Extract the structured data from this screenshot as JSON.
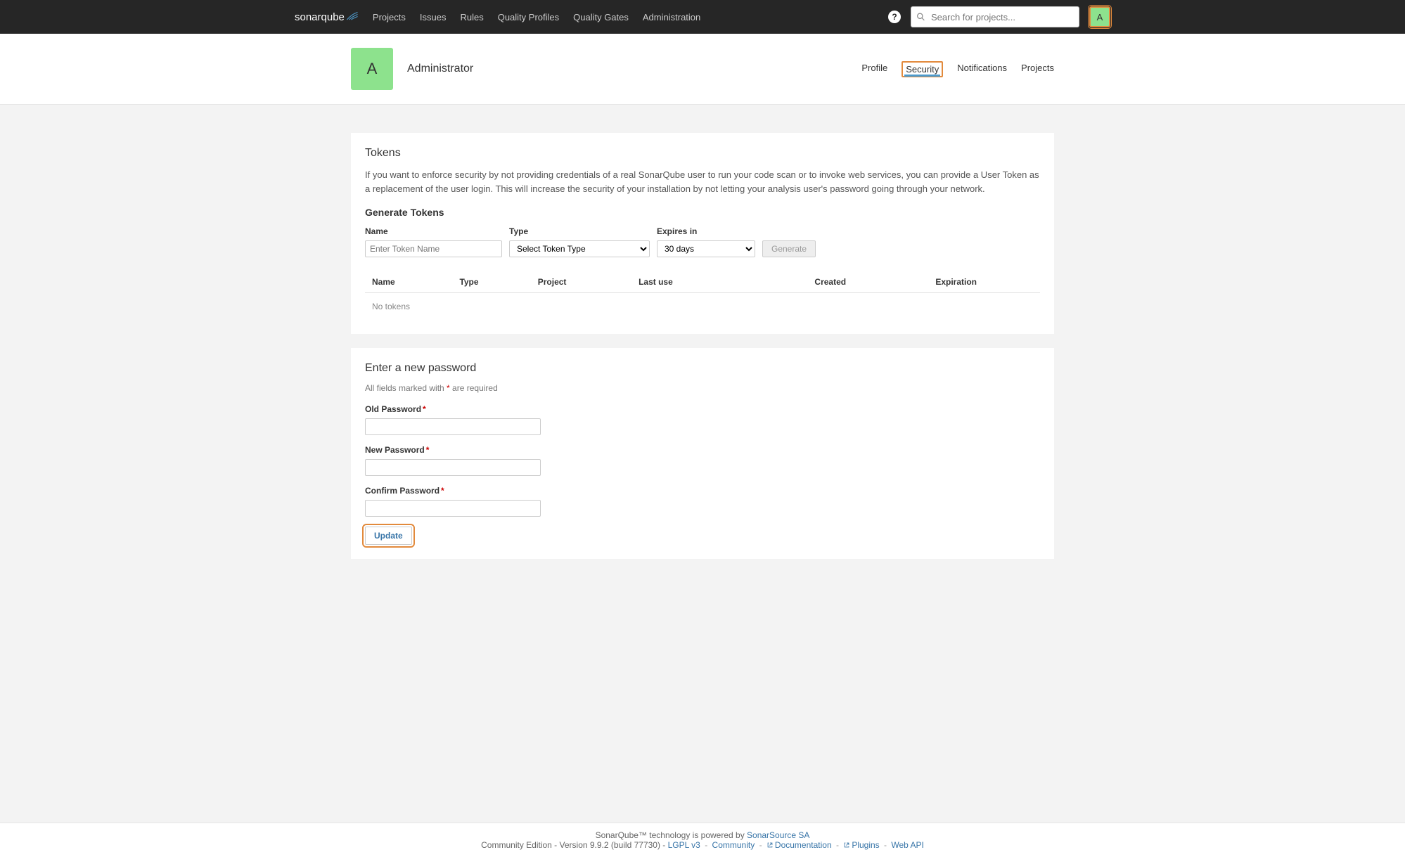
{
  "navbar": {
    "logo_prefix": "sonar",
    "logo_suffix": "qube",
    "links": [
      "Projects",
      "Issues",
      "Rules",
      "Quality Profiles",
      "Quality Gates",
      "Administration"
    ],
    "search_placeholder": "Search for projects...",
    "avatar_letter": "A"
  },
  "profile": {
    "avatar_letter": "A",
    "name": "Administrator",
    "tabs": [
      "Profile",
      "Security",
      "Notifications",
      "Projects"
    ],
    "active_tab": "Security"
  },
  "tokens_panel": {
    "title": "Tokens",
    "description": "If you want to enforce security by not providing credentials of a real SonarQube user to run your code scan or to invoke web services, you can provide a User Token as a replacement of the user login. This will increase the security of your installation by not letting your analysis user's password going through your network.",
    "generate_title": "Generate Tokens",
    "name_label": "Name",
    "name_placeholder": "Enter Token Name",
    "type_label": "Type",
    "type_placeholder": "Select Token Type",
    "expires_label": "Expires in",
    "expires_value": "30 days",
    "generate_btn": "Generate",
    "table": {
      "headers": [
        "Name",
        "Type",
        "Project",
        "Last use",
        "Created",
        "Expiration"
      ],
      "empty": "No tokens"
    }
  },
  "password_panel": {
    "title": "Enter a new password",
    "hint_prefix": "All fields marked with ",
    "hint_mark": "*",
    "hint_suffix": " are required",
    "old_label": "Old Password",
    "new_label": "New Password",
    "confirm_label": "Confirm Password",
    "update_btn": "Update"
  },
  "footer": {
    "line1_prefix": "SonarQube™ technology is powered by ",
    "line1_link": "SonarSource SA",
    "line2_prefix": "Community Edition - Version 9.9.2 (build 77730) - ",
    "links": [
      "LGPL v3",
      "Community",
      "Documentation",
      "Plugins",
      "Web API"
    ]
  }
}
